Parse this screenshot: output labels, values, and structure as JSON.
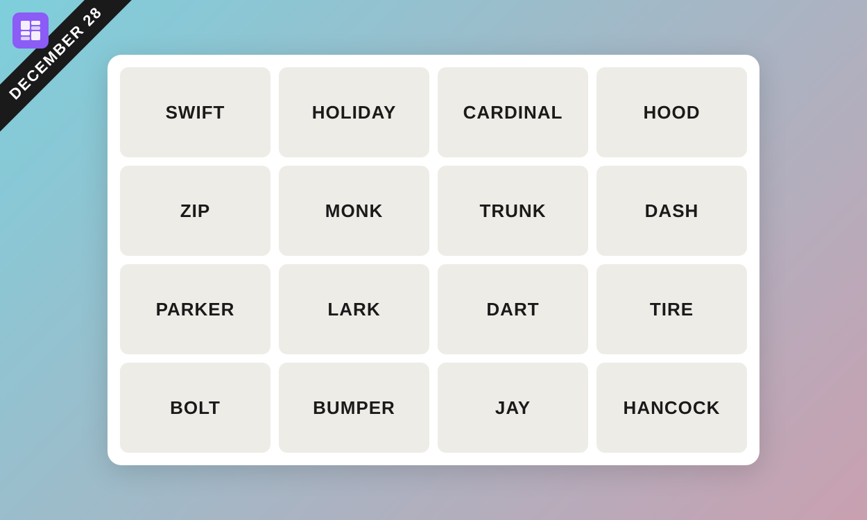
{
  "banner": {
    "date": "DECEMBER 28"
  },
  "grid": {
    "cells": [
      {
        "label": "SWIFT"
      },
      {
        "label": "HOLIDAY"
      },
      {
        "label": "CARDINAL"
      },
      {
        "label": "HOOD"
      },
      {
        "label": "ZIP"
      },
      {
        "label": "MONK"
      },
      {
        "label": "TRUNK"
      },
      {
        "label": "DASH"
      },
      {
        "label": "PARKER"
      },
      {
        "label": "LARK"
      },
      {
        "label": "DART"
      },
      {
        "label": "TIRE"
      },
      {
        "label": "BOLT"
      },
      {
        "label": "BUMPER"
      },
      {
        "label": "JAY"
      },
      {
        "label": "HANCOCK"
      }
    ]
  }
}
